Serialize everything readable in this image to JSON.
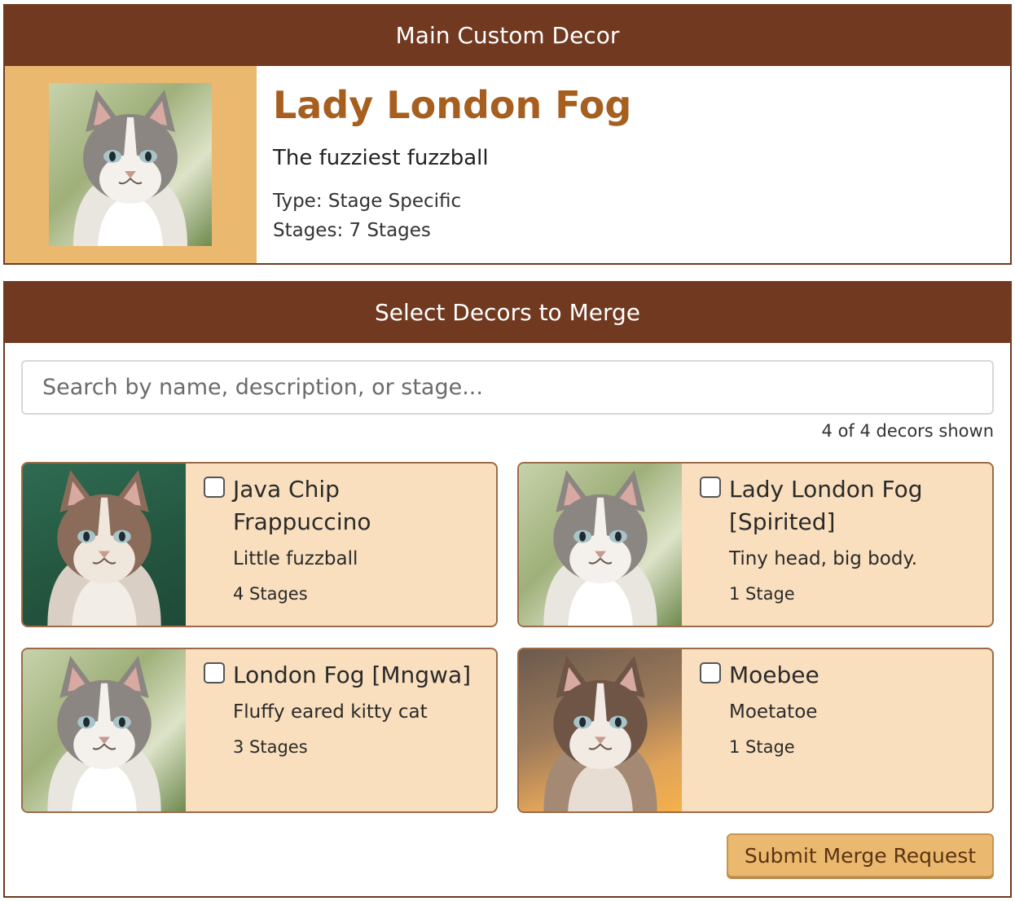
{
  "main": {
    "header": "Main Custom Decor",
    "title": "Lady London Fog",
    "description": "The fuzziest fuzzball",
    "type_line": "Type: Stage Specific",
    "stages_line": "Stages: 7 Stages"
  },
  "merge": {
    "header": "Select Decors to Merge",
    "search_placeholder": "Search by name, description, or stage...",
    "count_text": "4 of 4 decors shown",
    "submit_label": "Submit Merge Request",
    "cards": [
      {
        "title": "Java Chip Frappuccino",
        "description": "Little fuzzball",
        "stages": "4 Stages"
      },
      {
        "title": "Lady London Fog [Spirited]",
        "description": "Tiny head, big body.",
        "stages": "1 Stage"
      },
      {
        "title": "London Fog [Mngwa]",
        "description": "Fluffy eared kitty cat",
        "stages": "3 Stages"
      },
      {
        "title": "Moebee",
        "description": "Moetatoe",
        "stages": "1 Stage"
      }
    ]
  },
  "colors": {
    "header_bg": "#703920",
    "accent_gold": "#eab86e",
    "card_bg": "#f9dfbd",
    "title_brown": "#a65f1f"
  }
}
